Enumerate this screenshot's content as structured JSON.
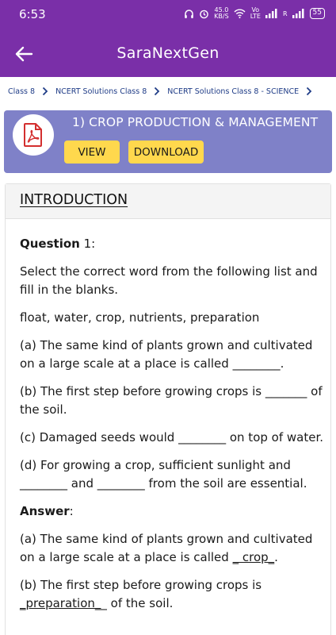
{
  "status_bar": {
    "time": "6:53",
    "speed_top": "45.0",
    "speed_bottom": "KB/S",
    "net_label_top": "Vo",
    "net_label_bottom": "LTE",
    "r_label": "R",
    "battery": "55"
  },
  "app_bar": {
    "title": "SaraNextGen",
    "back_icon": "arrow-left-icon"
  },
  "breadcrumb": {
    "items": [
      "Class 8",
      "NCERT Solutions Class 8",
      "NCERT Solutions Class 8 - SCIENCE"
    ]
  },
  "banner": {
    "title": "1) CROP PRODUCTION & MANAGEMENT",
    "view_label": "VIEW",
    "download_label": "DOWNLOAD",
    "icon": "pdf-icon"
  },
  "content": {
    "heading": "INTRODUCTION",
    "question_word": "Question",
    "question_num": " 1:",
    "prompt": "Select the correct word from the following list and fill in the blanks.",
    "word_list": "float, water, crop, nutrients, preparation",
    "questions": [
      "(a) The same kind of plants grown and cultivated on a large scale at a place is called ________.",
      "(b) The first step before growing crops is _______ of the soil.",
      "(c) Damaged seeds would ________ on top of water.",
      "(d) For growing a crop, sufficient sunlight and ________ and ________ from the soil are essential."
    ],
    "answer_word": "Answer",
    "answer_colon": ":",
    "answers": {
      "a_prefix": "(a) The same kind of plants grown and cultivated on a large scale at a place is called ",
      "a_fill": "_ crop_",
      "a_suffix": ".",
      "b_prefix": "(b) The first step before growing crops is ",
      "b_fill": "_preparation_",
      "b_suffix": "_ of the soil."
    }
  },
  "colors": {
    "primary": "#7a2fa8",
    "banner": "#7f81c8",
    "button": "#ffd84d",
    "breadcrumb_text": "#1f3c87"
  }
}
